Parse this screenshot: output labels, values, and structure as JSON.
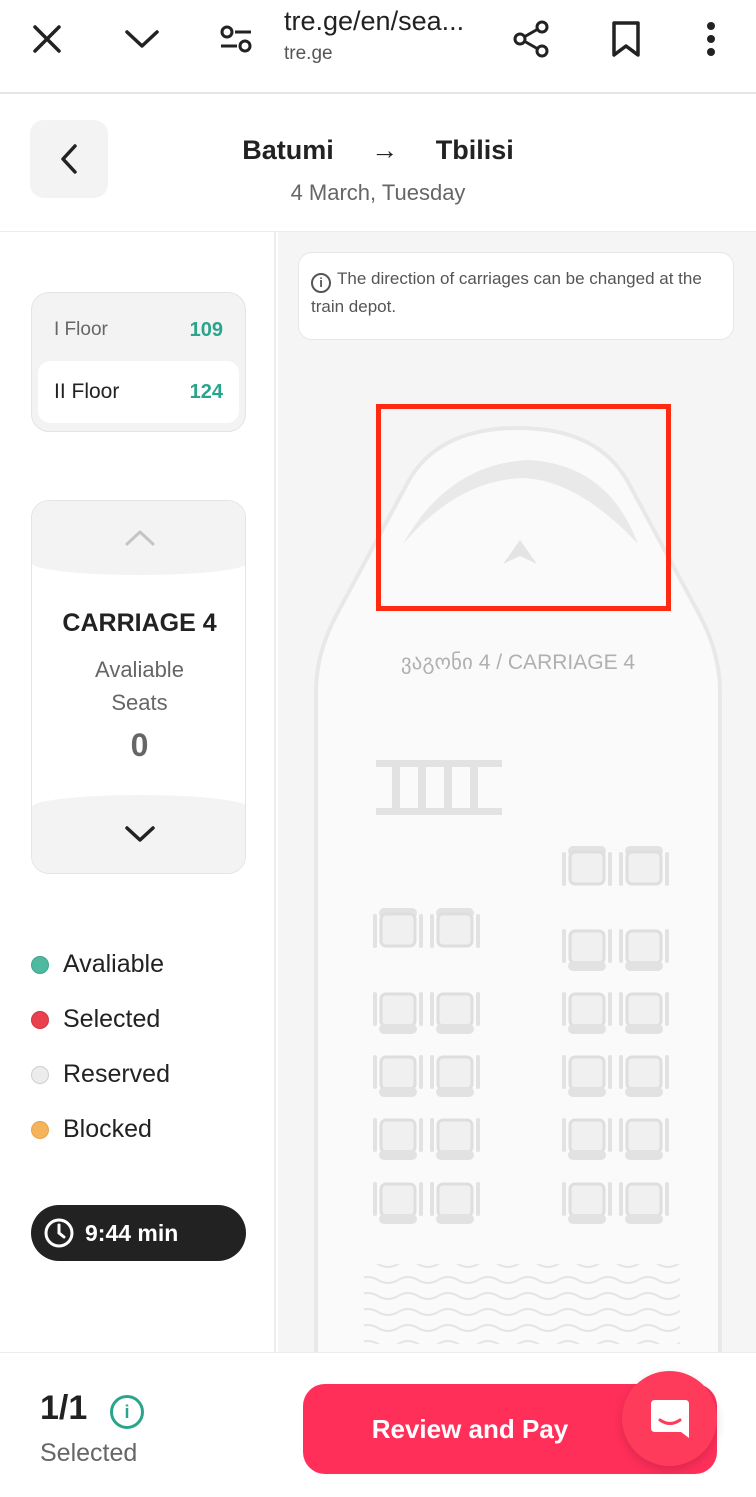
{
  "browser": {
    "url": "tre.ge/en/sea...",
    "domain": "tre.ge"
  },
  "header": {
    "from": "Batumi",
    "arrow": "→",
    "to": "Tbilisi",
    "date": "4 March, Tuesday"
  },
  "floors": [
    {
      "label": "I Floor",
      "count": "109"
    },
    {
      "label": "II Floor",
      "count": "124"
    }
  ],
  "carriage": {
    "title": "CARRIAGE 4",
    "available_label": "Avaliable\nSeats",
    "available_count": "0"
  },
  "legend": [
    {
      "label": "Avaliable",
      "color": "#4fb99f"
    },
    {
      "label": "Selected",
      "color": "#e8414d"
    },
    {
      "label": "Reserved",
      "color": "#ececec"
    },
    {
      "label": "Blocked",
      "color": "#f5b35c"
    }
  ],
  "timer": "9:44 min",
  "notice": "The direction of carriages can be changed at the train depot.",
  "car_name": "ვაგონი 4 / CARRIAGE 4",
  "bottom": {
    "count": "1/1",
    "info": "i",
    "label": "Selected",
    "pay_label": "Review and Pay"
  }
}
